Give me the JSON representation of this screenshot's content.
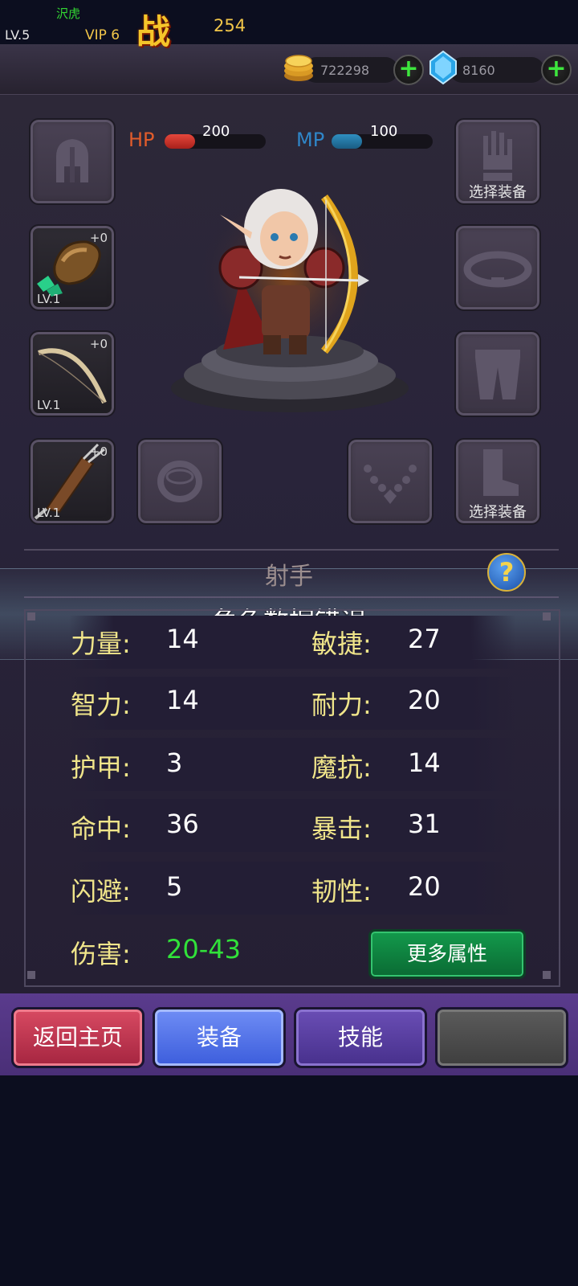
{
  "header": {
    "player_name": "沢虎",
    "player_level": "LV.5",
    "vip": "VIP 6",
    "power_glyph": "战",
    "power": "254",
    "gold": "722298",
    "gems": "8160",
    "add_symbol": "+"
  },
  "vitals": {
    "hp_label": "HP",
    "hp_value": "200",
    "hp_fill": 0.3,
    "mp_label": "MP",
    "mp_value": "100",
    "mp_fill": 0.3
  },
  "slots": {
    "helmet": {
      "icon": "helmet-icon"
    },
    "glove": {
      "icon": "glove-icon",
      "caption": "选择装备"
    },
    "armor": {
      "icon": "armor-stone-icon",
      "level": "LV.1",
      "plus": "+0"
    },
    "belt": {
      "icon": "belt-icon"
    },
    "weapon": {
      "icon": "bow-icon",
      "level": "LV.1",
      "plus": "+0"
    },
    "pants": {
      "icon": "pants-icon"
    },
    "quiver": {
      "icon": "quiver-icon",
      "level": "LV.1",
      "plus": "+0"
    },
    "ring": {
      "icon": "ring-icon"
    },
    "necklace": {
      "icon": "necklace-icon"
    },
    "boots": {
      "icon": "boots-icon",
      "caption": "选择装备"
    }
  },
  "class_name": "射手",
  "help_symbol": "?",
  "error_message": "角色数据错误",
  "stats": [
    {
      "l_label": "力量:",
      "l_value": "14",
      "r_label": "敏捷:",
      "r_value": "27"
    },
    {
      "l_label": "智力:",
      "l_value": "14",
      "r_label": "耐力:",
      "r_value": "20"
    },
    {
      "l_label": "护甲:",
      "l_value": "3",
      "r_label": "魔抗:",
      "r_value": "14"
    },
    {
      "l_label": "命中:",
      "l_value": "36",
      "r_label": "暴击:",
      "r_value": "31"
    },
    {
      "l_label": "闪避:",
      "l_value": "5",
      "r_label": "韧性:",
      "r_value": "20"
    }
  ],
  "damage": {
    "label": "伤害:",
    "value": "20-43"
  },
  "more_attributes": "更多属性",
  "tabs": {
    "home": "返回主页",
    "equip": "装备",
    "skill": "技能",
    "empty": ""
  },
  "colors": {
    "gold": "#f2c649",
    "green": "#31e23a",
    "hp": "#e5473c",
    "mp": "#2f8fc0"
  }
}
